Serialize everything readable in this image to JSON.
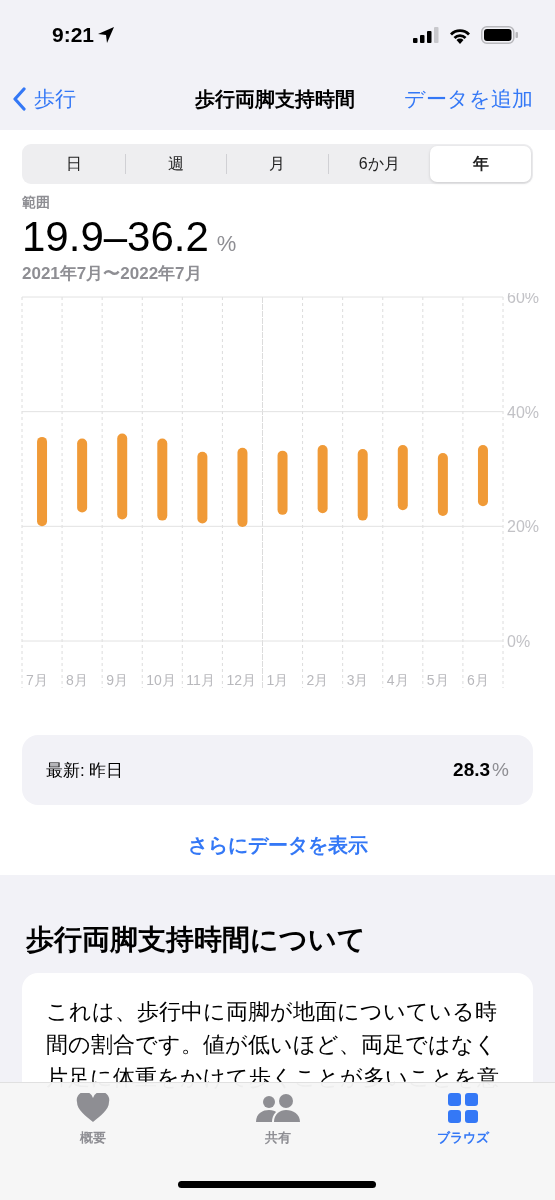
{
  "status_bar": {
    "time": "9:21"
  },
  "nav": {
    "back": "歩行",
    "title": "歩行両脚支持時間",
    "action": "データを追加"
  },
  "segments": [
    {
      "label": "日",
      "selected": false
    },
    {
      "label": "週",
      "selected": false
    },
    {
      "label": "月",
      "selected": false
    },
    {
      "label": "6か月",
      "selected": false
    },
    {
      "label": "年",
      "selected": true
    }
  ],
  "summary": {
    "label": "範囲",
    "value": "19.9–36.2",
    "unit": "%",
    "date_range": "2021年7月〜2022年7月"
  },
  "chart": {
    "chart_data": {
      "type": "candlestick",
      "categories": [
        "7月",
        "8月",
        "9月",
        "10月",
        "11月",
        "12月",
        "1月",
        "2月",
        "3月",
        "4月",
        "5月",
        "6月"
      ],
      "ylim": [
        0,
        60
      ],
      "yticks": [
        {
          "value": 0,
          "label": "0%"
        },
        {
          "value": 20,
          "label": "20%"
        },
        {
          "value": 40,
          "label": "40%"
        },
        {
          "value": 60,
          "label": "60%"
        }
      ],
      "series": [
        {
          "color": "#f09a37",
          "ohlc": [
            [
              20.0,
              35.6,
              20.0,
              35.6
            ],
            [
              22.4,
              35.3,
              22.4,
              35.3
            ],
            [
              21.2,
              36.2,
              21.2,
              36.2
            ],
            [
              21.0,
              35.3,
              21.0,
              35.3
            ],
            [
              20.5,
              33.0,
              20.5,
              33.0
            ],
            [
              19.9,
              33.7,
              19.9,
              33.7
            ],
            [
              22.0,
              33.2,
              22.0,
              33.2
            ],
            [
              22.3,
              34.2,
              22.3,
              34.2
            ],
            [
              21.0,
              33.5,
              21.0,
              33.5
            ],
            [
              22.8,
              34.2,
              22.8,
              34.2
            ],
            [
              21.8,
              32.8,
              21.8,
              32.8
            ],
            [
              23.5,
              34.2,
              23.5,
              34.2
            ]
          ]
        }
      ]
    }
  },
  "latest": {
    "label": "最新: 昨日",
    "value": "28.3",
    "unit": "%"
  },
  "more_link": "さらにデータを表示",
  "about": {
    "heading": "歩行両脚支持時間について",
    "text": "これは、歩行中に両脚が地面についている時間の割合です。値が低いほど、両足ではなく片足に体重をかけて歩くことが多いことを意"
  },
  "tab_bar": [
    {
      "label": "概要",
      "kind": "heart",
      "selected": false
    },
    {
      "label": "共有",
      "kind": "people",
      "selected": false
    },
    {
      "label": "ブラウズ",
      "kind": "grid",
      "selected": true
    }
  ]
}
